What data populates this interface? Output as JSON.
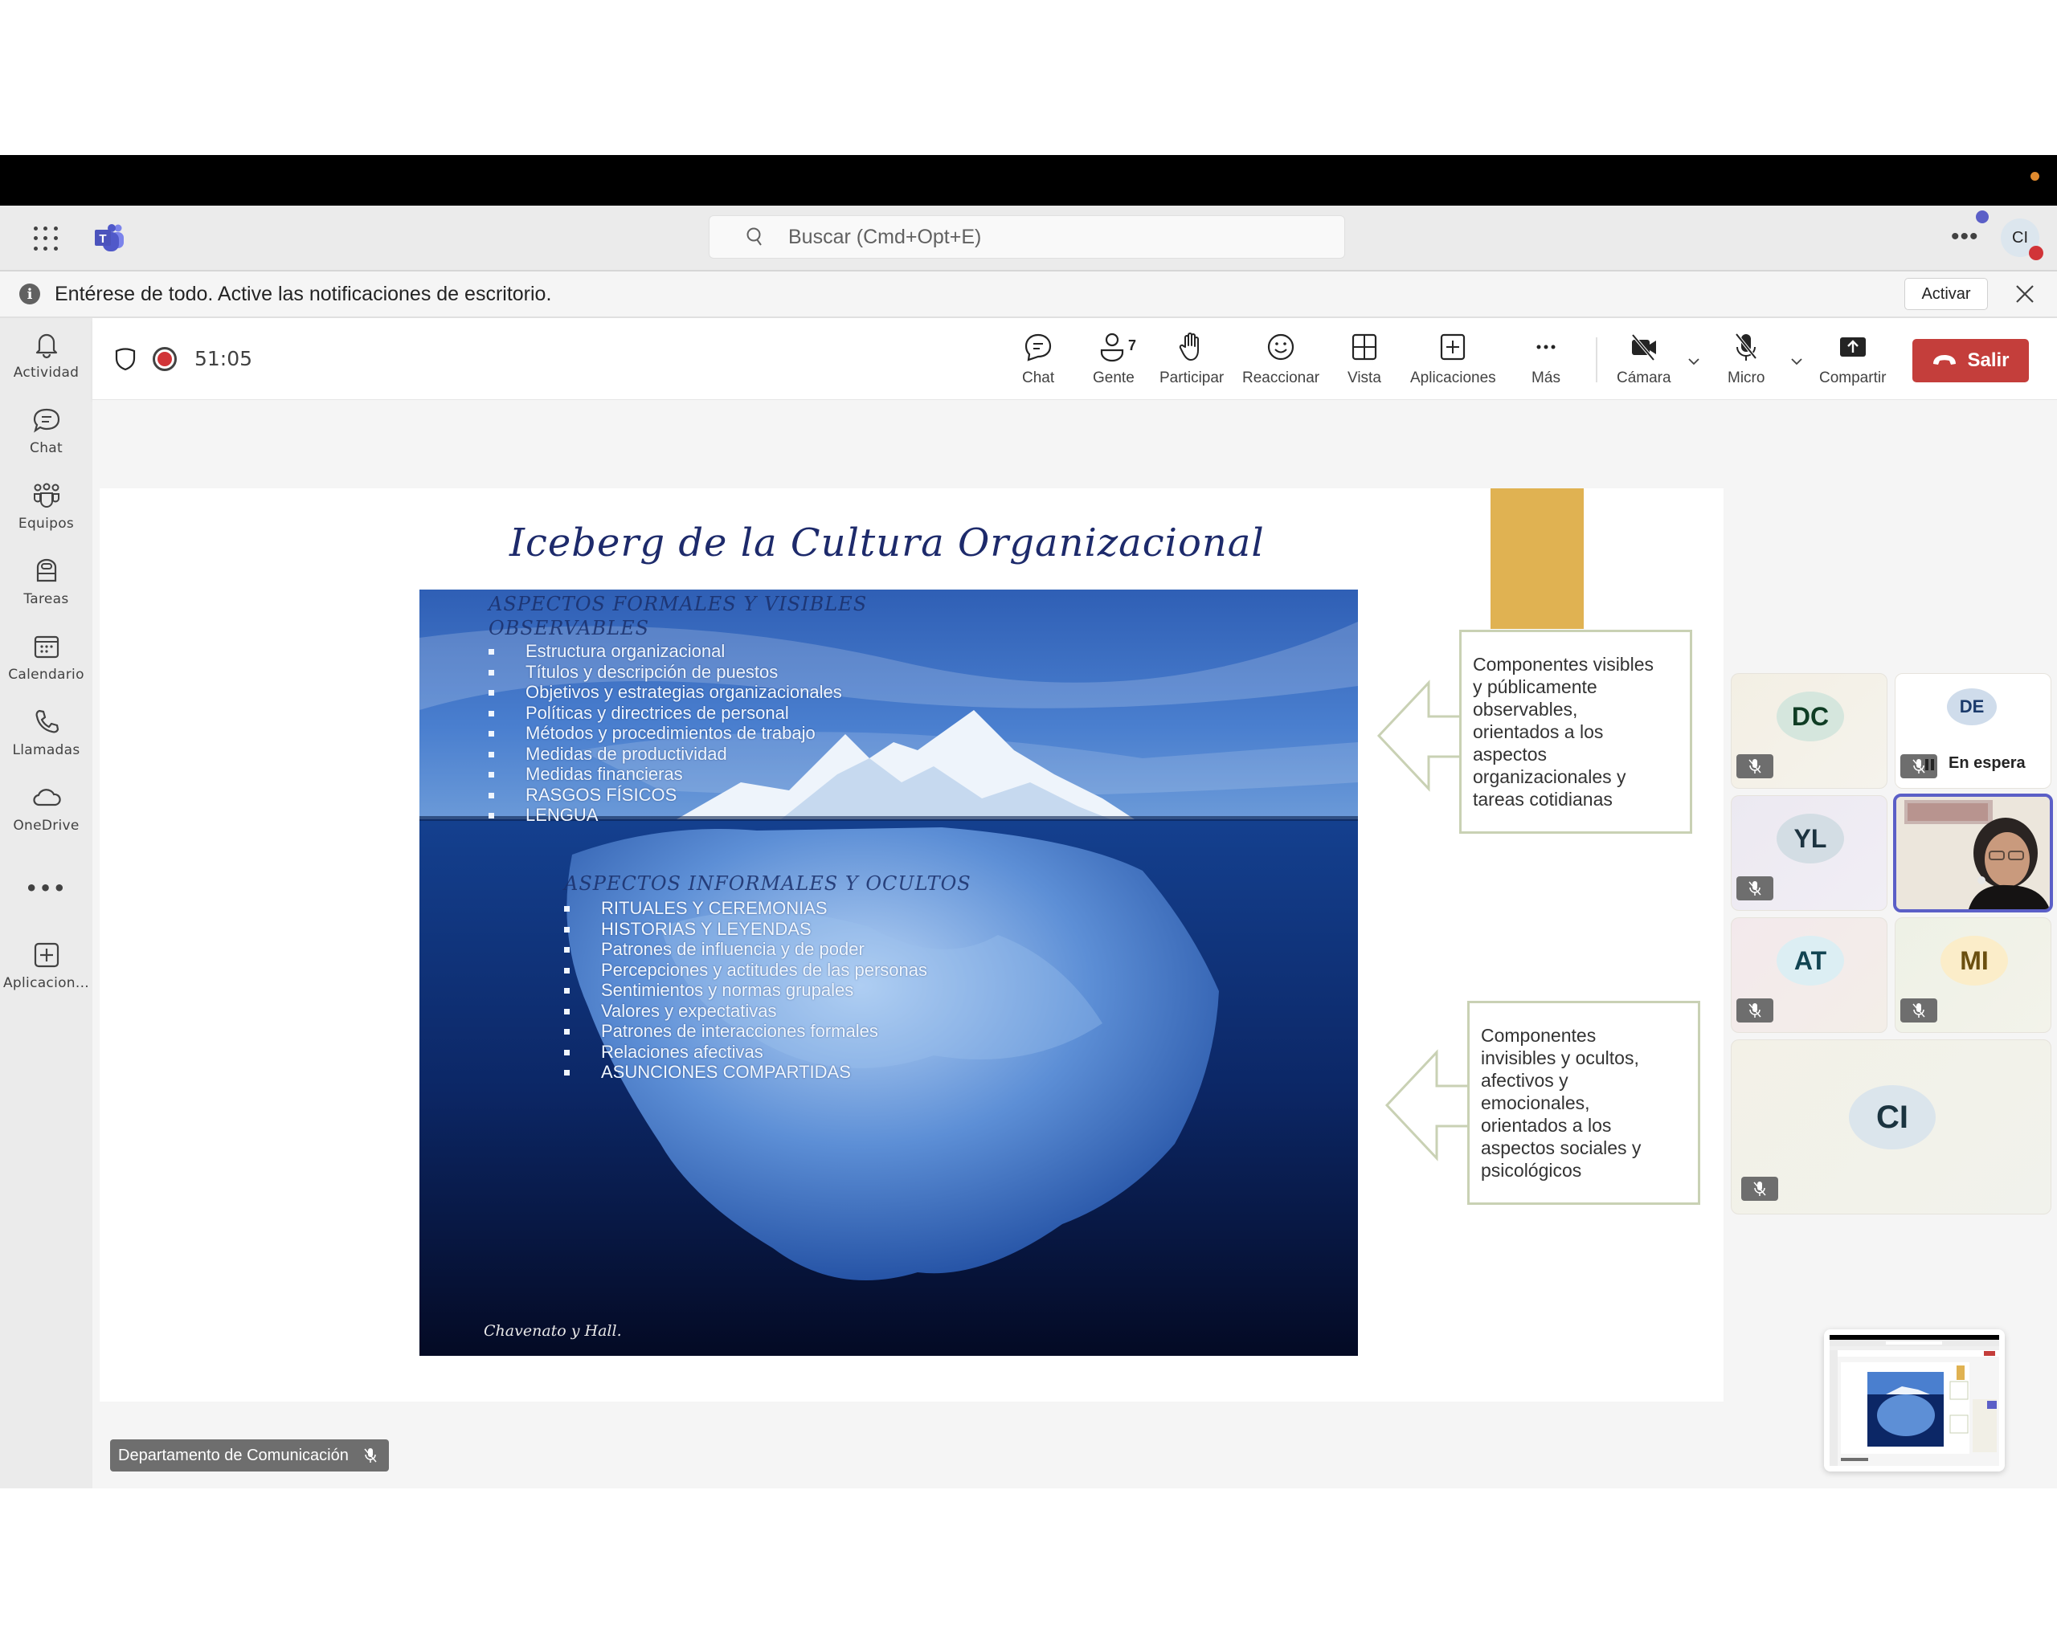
{
  "titlebar": {
    "search_placeholder": "Buscar (Cmd+Opt+E)",
    "more_label": "•••",
    "user_initials": "CI"
  },
  "notification": {
    "message": "Entérese de todo. Active las notificaciones de escritorio.",
    "action_label": "Activar"
  },
  "rail": {
    "items": [
      {
        "label": "Actividad",
        "icon": "bell-icon"
      },
      {
        "label": "Chat",
        "icon": "chat-icon"
      },
      {
        "label": "Equipos",
        "icon": "teams-icon"
      },
      {
        "label": "Tareas",
        "icon": "tasks-icon"
      },
      {
        "label": "Calendario",
        "icon": "calendar-icon"
      },
      {
        "label": "Llamadas",
        "icon": "phone-icon"
      },
      {
        "label": "OneDrive",
        "icon": "cloud-icon"
      },
      {
        "label": "•••",
        "icon": "more-icon"
      },
      {
        "label": "Aplicacion...",
        "icon": "add-app-icon"
      }
    ]
  },
  "meeting": {
    "timer": "51:05",
    "toolbar": {
      "chat": "Chat",
      "people": "Gente",
      "people_count": "7",
      "raise": "Participar",
      "react": "Reaccionar",
      "view": "Vista",
      "apps": "Aplicaciones",
      "more": "Más",
      "camera": "Cámara",
      "mic": "Micro",
      "share": "Compartir",
      "leave": "Salir"
    },
    "presenter_name": "Departamento de Comunicación"
  },
  "slide": {
    "title": "Iceberg de la Cultura Organizacional",
    "visible_heading_line1": "ASPECTOS FORMALES Y VISIBLES",
    "visible_heading_line2": "OBSERVABLES",
    "visible_items": [
      "Estructura organizacional",
      "Títulos y descripción de puestos",
      "Objetivos y estrategias organizacionales",
      "Políticas y directrices de personal",
      "Métodos y procedimientos de trabajo",
      "Medidas de productividad",
      "Medidas financieras",
      "RASGOS FÍSICOS",
      "LENGUA"
    ],
    "hidden_heading": "ASPECTOS INFORMALES Y OCULTOS",
    "hidden_items": [
      "RITUALES Y CEREMONIAS",
      "HISTORIAS Y LEYENDAS",
      "Patrones de influencia y de poder",
      "Percepciones y actitudes de las personas",
      "Sentimientos y normas grupales",
      "Valores y expectativas",
      "Patrones de interacciones formales",
      "Relaciones afectivas",
      "ASUNCIONES COMPARTIDAS"
    ],
    "credit": "Chavenato y Hall.",
    "callout_visible": [
      "Componentes visibles",
      "y públicamente",
      "observables,",
      "orientados a los",
      "aspectos",
      "organizacionales y",
      "tareas cotidianas"
    ],
    "callout_hidden": [
      "Componentes",
      "invisibles y ocultos,",
      "afectivos y",
      "emocionales,",
      "orientados a los",
      "aspectos sociales y",
      "psicológicos"
    ]
  },
  "participants": [
    {
      "initials": "DC",
      "muted": true,
      "bg": "#d5e6dd",
      "fg": "#0f3d24"
    },
    {
      "initials": "DE",
      "muted": true,
      "on_hold": true,
      "status": "En espera",
      "bg": "#cfdceb",
      "fg": "#1b3a6b"
    },
    {
      "initials": "YL",
      "muted": true,
      "bg": "#d3dde4",
      "fg": "#1c3340"
    },
    {
      "initials": "",
      "video": true,
      "active_speaker": true
    },
    {
      "initials": "AT",
      "muted": true,
      "bg": "#dceef3",
      "fg": "#124452"
    },
    {
      "initials": "MI",
      "muted": true,
      "bg": "#fbedc9",
      "fg": "#6b5010"
    },
    {
      "initials": "CI",
      "muted": true,
      "bg": "#dbe5ec",
      "fg": "#1b3440"
    }
  ],
  "colors": {
    "brand": "#5b5fc7",
    "leave": "#c43e3b",
    "recording": "#d13438",
    "slide_accent": "#e0b252",
    "callout_border": "#c9d1b4"
  }
}
